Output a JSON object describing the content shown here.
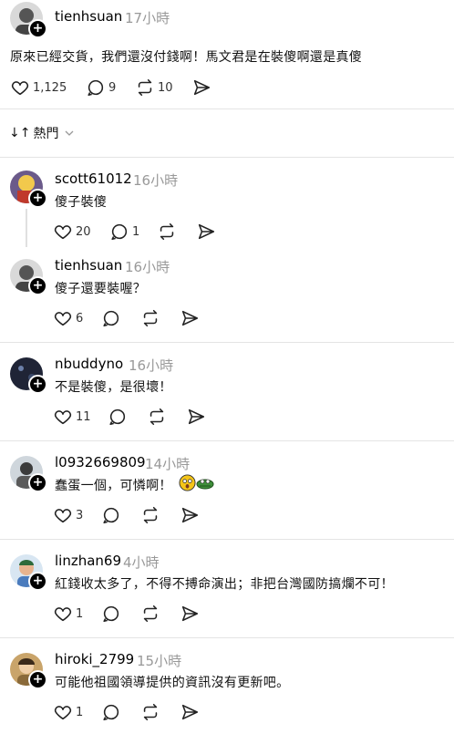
{
  "post": {
    "username": "tienhsuan",
    "time": "17小時",
    "text": "原來已經交貨，我們還沒付錢啊！馬文君是在裝傻啊還是真傻",
    "likes": "1,125",
    "comments": "9",
    "reposts": "10"
  },
  "sort": {
    "label": "熱門"
  },
  "replies": [
    {
      "username": "scott61012",
      "time": "16小時",
      "text": "傻子裝傻",
      "likes": "20",
      "comments": "1"
    },
    {
      "username": "tienhsuan",
      "time": "16小時",
      "text": "傻子還要裝喔？",
      "likes": "6"
    },
    {
      "username": "nbuddyno",
      "time": "16小時",
      "text": "不是裝傻，是很壞！",
      "likes": "11"
    },
    {
      "username": "l0932669809",
      "time": "14小時",
      "text": "蠢蛋一個，可憐啊！",
      "likes": "3"
    },
    {
      "username": "linzhan69",
      "time": "4小時",
      "text": "紅錢收太多了，不得不搏命演出；非把台灣國防搞爛不可！",
      "likes": "1"
    },
    {
      "username": "hiroki_2799",
      "time": "15小時",
      "text": "可能他祖國領導提供的資訊沒有更新吧。",
      "likes": "1"
    }
  ]
}
